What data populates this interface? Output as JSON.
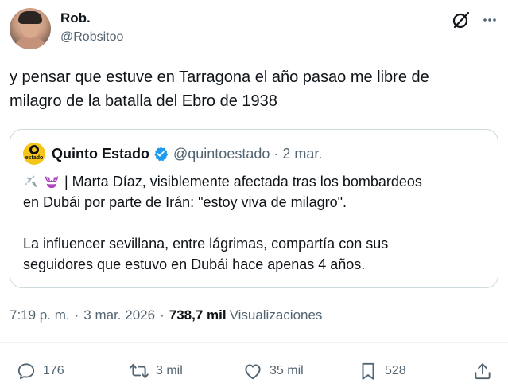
{
  "author": {
    "display_name": "Rob.",
    "handle": "@Robsitoo"
  },
  "tweet": {
    "text_line1": "y pensar que estuve en Tarragona el año pasao me libre de",
    "text_line2": "milagro de la batalla del Ebro de 1938"
  },
  "quote": {
    "logo_text": "estado",
    "display_name": "Quinto Estado",
    "handle": "@quintoestado",
    "dot": "·",
    "date": "2 mar.",
    "line1": "| Marta Díaz, visiblemente afectada tras los bombardeos",
    "line2": "en Dubái por parte de Irán: \"estoy viva de milagro\".",
    "line3": "La influencer sevillana, entre lágrimas, compartía con sus",
    "line4": "seguidores que estuvo en Dubái hace apenas 4 años.",
    "emoji_icons": [
      "airplane-icon",
      "bikini-icon"
    ],
    "verified_color": "#1d9bf0",
    "logo_color": "#f5c518"
  },
  "meta": {
    "time": "7:19 p. m.",
    "sep1": "·",
    "date": "3 mar. 2026",
    "sep2": "·",
    "views_count": "738,7 mil",
    "views_label": "Visualizaciones"
  },
  "actions": {
    "replies": "176",
    "reposts": "3 mil",
    "likes": "35 mil",
    "bookmarks": "528"
  },
  "header_icons": [
    "grok-icon",
    "more-icon"
  ],
  "colors": {
    "text": "#0f1419",
    "secondary": "#536471",
    "border": "#cfd9de",
    "accent": "#1d9bf0"
  }
}
